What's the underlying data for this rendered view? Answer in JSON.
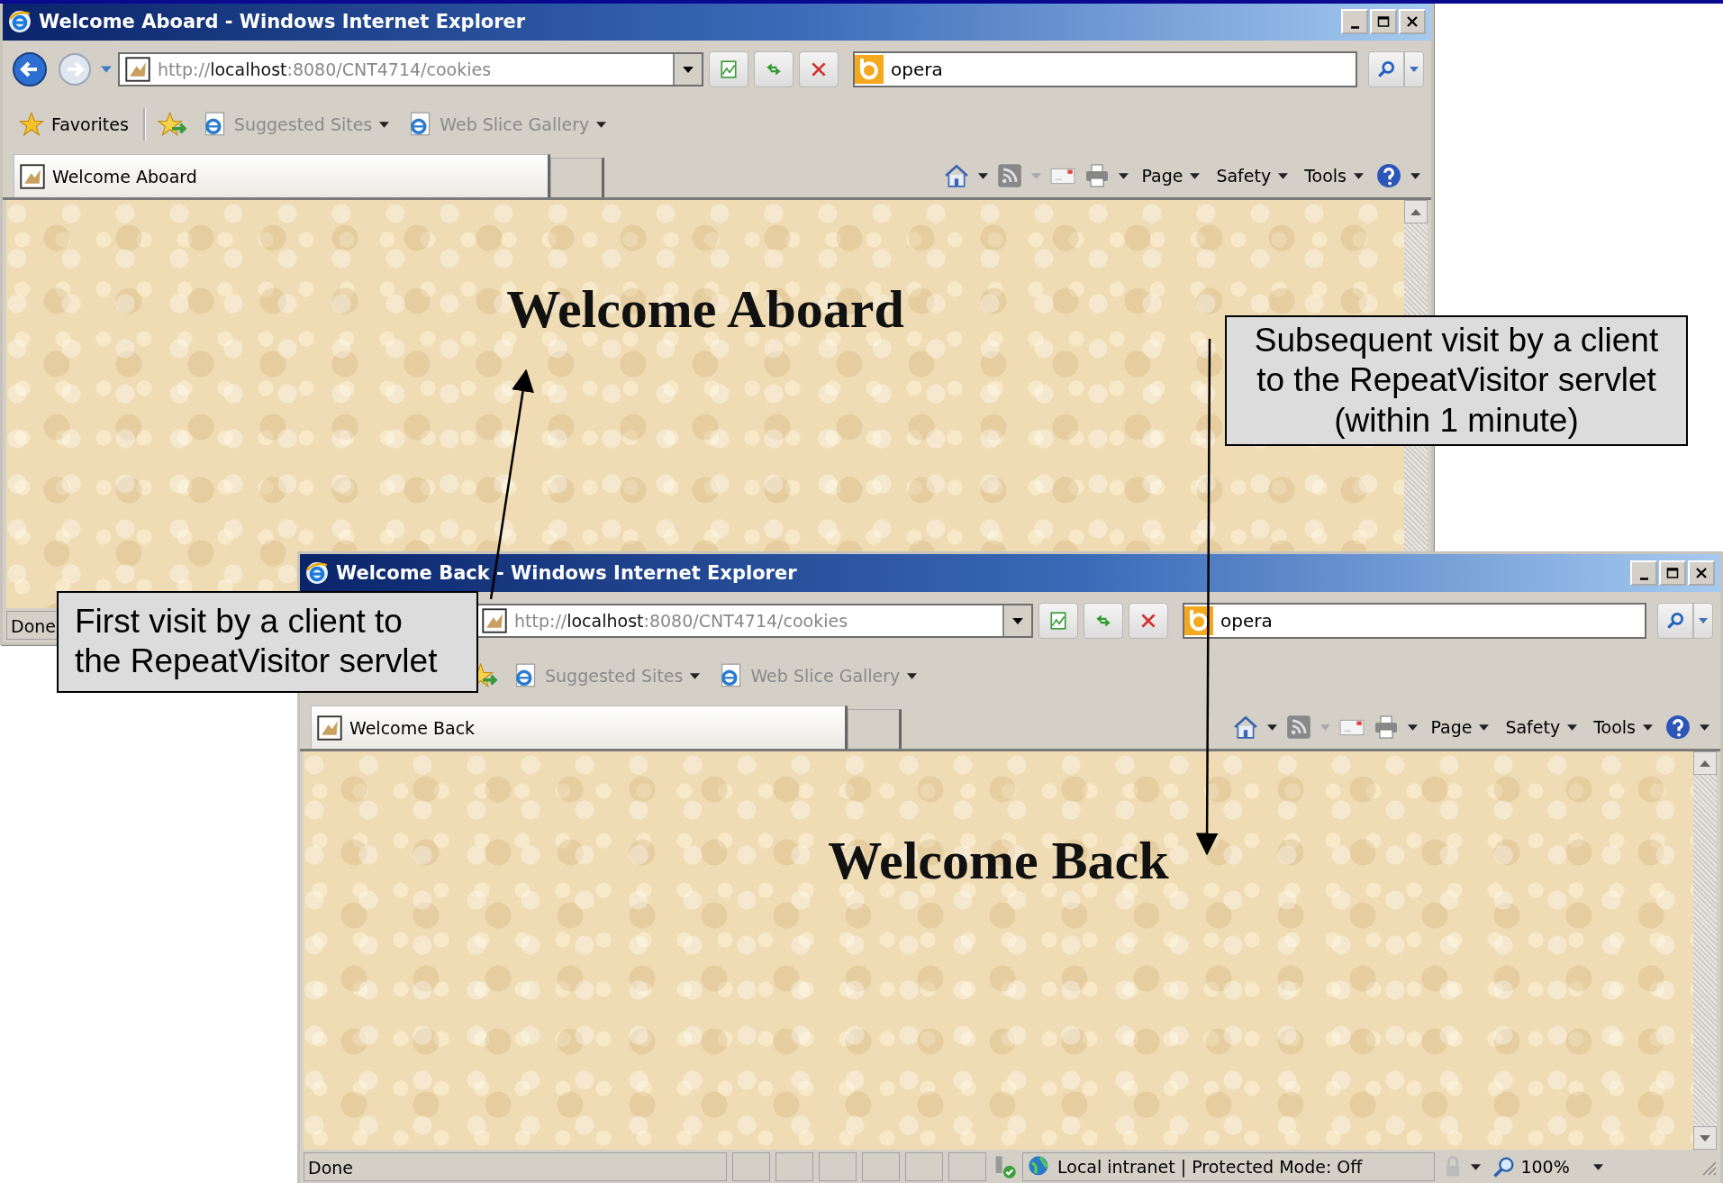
{
  "windows": [
    {
      "title": "Welcome Aboard - Windows Internet Explorer",
      "address": "http://**localhost**:8080/CNT4714/cookies",
      "search": "opera",
      "favorites_label": "Favorites",
      "favorites_links": [
        "Suggested Sites",
        "Web Slice Gallery"
      ],
      "tab_title": "Welcome Aboard",
      "commands": [
        "Page",
        "Safety",
        "Tools"
      ],
      "heading": "Welcome Aboard",
      "status": {
        "text": "Done"
      }
    },
    {
      "title": "Welcome Back - Windows Internet Explorer",
      "address": "http://**localhost**:8080/CNT4714/cookies",
      "search": "opera",
      "favorites_links": [
        "Suggested Sites",
        "Web Slice Gallery"
      ],
      "tab_title": "Welcome Back",
      "commands": [
        "Page",
        "Safety",
        "Tools"
      ],
      "heading": "Welcome Back",
      "status": {
        "text": "Done",
        "zone": "Local intranet | Protected Mode: Off",
        "zoom": "100%"
      }
    }
  ],
  "callouts": [
    {
      "text": "First visit by a client to the RepeatVisitor servlet"
    },
    {
      "text": "Subsequent visit by a client to the RepeatVisitor servlet (within 1 minute)"
    }
  ]
}
